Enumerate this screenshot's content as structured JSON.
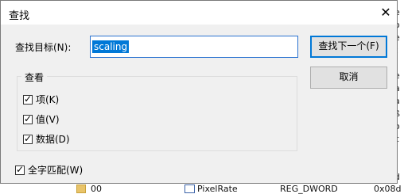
{
  "background": {
    "bottom_row": {
      "name": "00",
      "value_name": "PixelRate",
      "type": "REG_DWORD",
      "data": "0x08d"
    },
    "right_edge_glyphs": [
      "e",
      "o",
      "e",
      "t",
      "l",
      "e",
      "a",
      "a",
      "ß",
      "o",
      "c",
      "l",
      "l",
      "d"
    ]
  },
  "dialog": {
    "title": "查找",
    "find_label": "查找目标(N):",
    "search_value": "scaling",
    "buttons": {
      "find_next": "查找下一个(F)",
      "cancel": "取消"
    },
    "look_at_group": {
      "title": "查看",
      "options": [
        {
          "label": "项(K)",
          "checked": true
        },
        {
          "label": "值(V)",
          "checked": true
        },
        {
          "label": "数据(D)",
          "checked": true
        }
      ]
    },
    "match_whole": {
      "label": "全字匹配(W)",
      "checked": true
    }
  },
  "colors": {
    "dialog_bg": "#f0f0f0",
    "selection": "#0078d7",
    "default_button_border": "#0078d7"
  }
}
